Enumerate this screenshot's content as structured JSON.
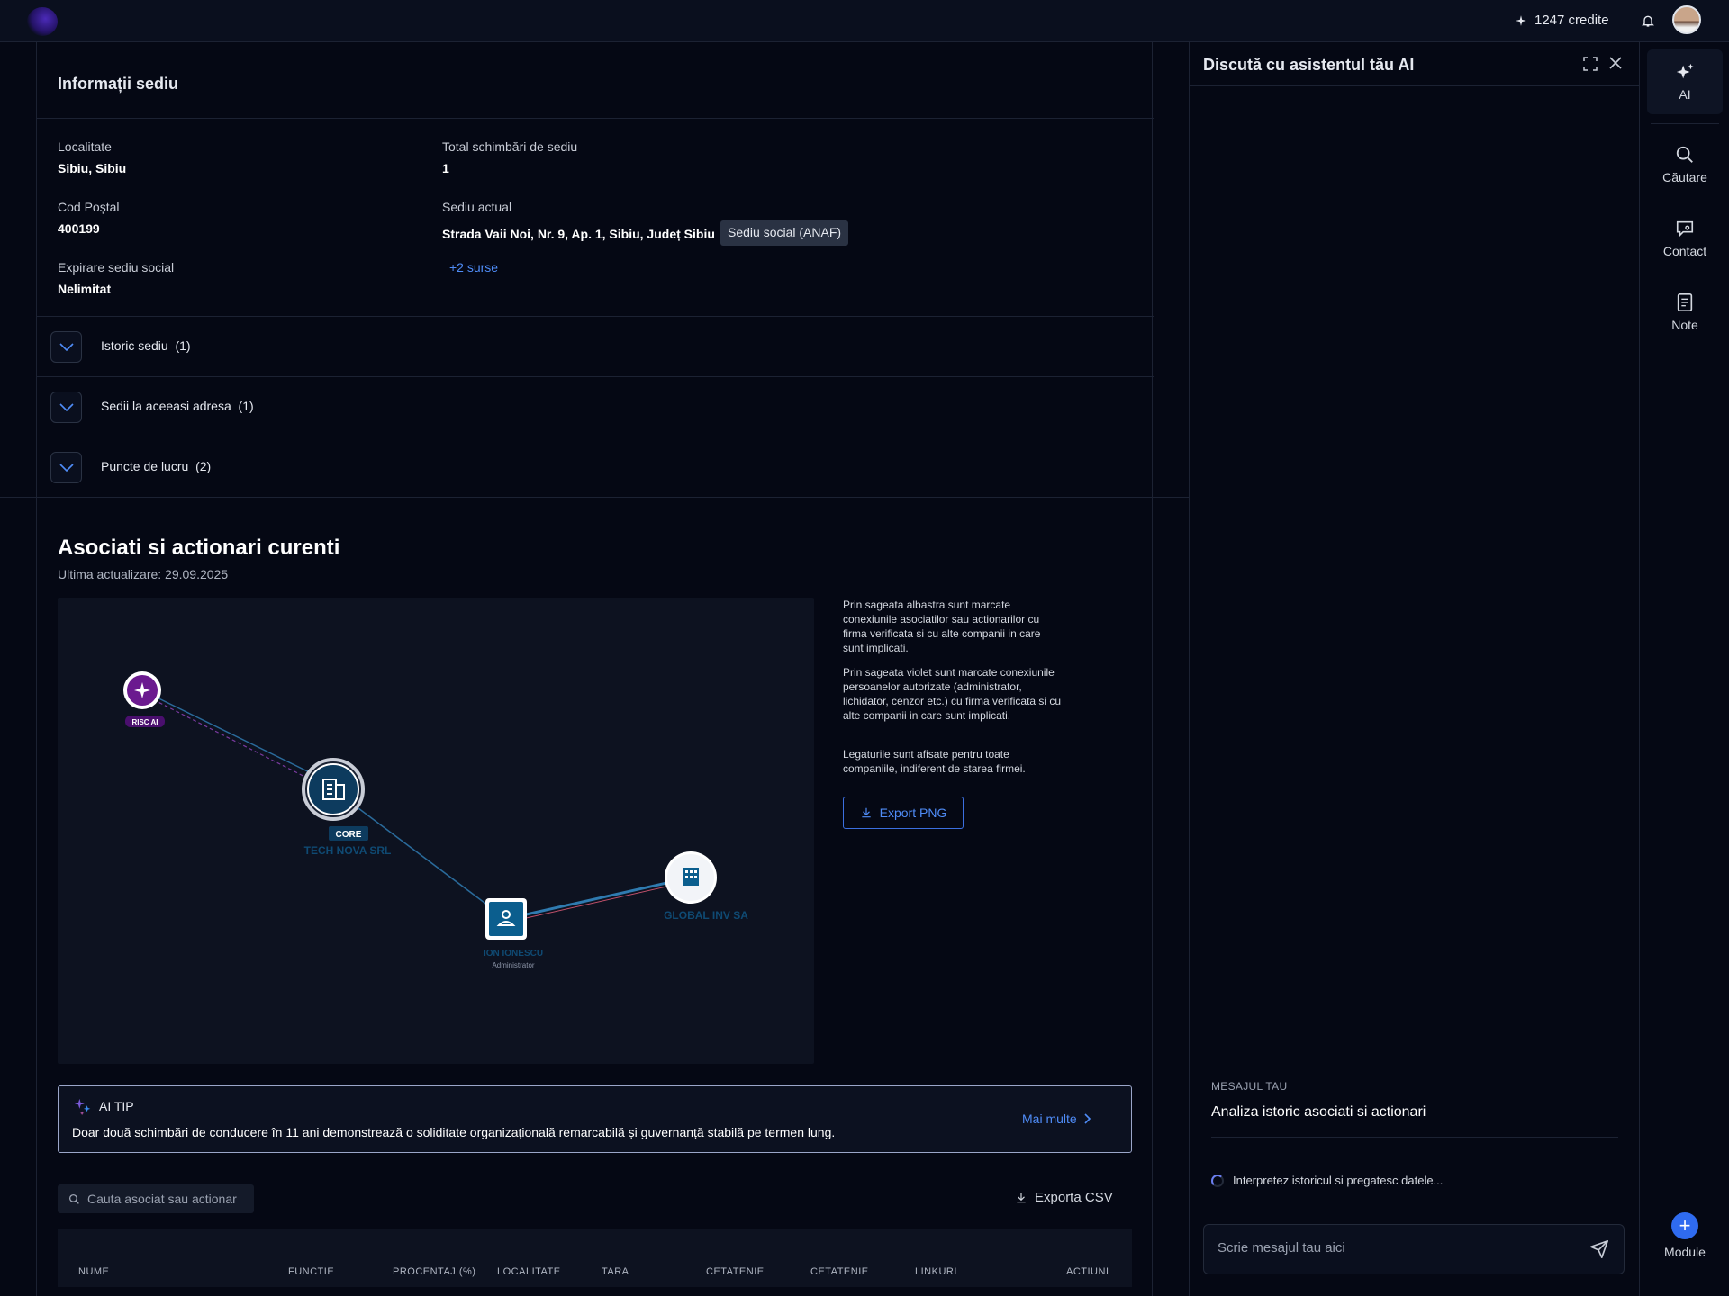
{
  "topbar": {
    "credits": "1247 credite"
  },
  "info": {
    "title": "Informații sediu",
    "localitate_label": "Localitate",
    "localitate_value": "Sibiu,  Sibiu",
    "cod_label": "Cod Poștal",
    "cod_value": "400199",
    "expirare_label": "Expirare sediu social",
    "expirare_value": "Nelimitat",
    "total_label": "Total schimbări de sediu",
    "total_value": "1",
    "sediu_label": "Sediu actual",
    "sediu_value": "Strada Vaii Noi, Nr. 9, Ap. 1, Sibiu, Județ Sibiu",
    "sediu_tag": "Sediu social (ANAF)",
    "sources_link": "+2 surse"
  },
  "accordion": [
    {
      "label": "Istoric sediu",
      "count": "(1)"
    },
    {
      "label": "Sedii la aceeasi adresa",
      "count": "(1)"
    },
    {
      "label": "Puncte de lucru",
      "count": "(2)"
    }
  ],
  "associates": {
    "title": "Asociati si actionari curenti",
    "updated": "Ultima actualizare: 29.09.2025",
    "graph": {
      "risk_badge": "RISC AI",
      "core_badge": "CORE",
      "core_name": "TECH NOVA SRL",
      "person_name": "ION IONESCU",
      "person_role": "Administrator",
      "company_name": "GLOBAL INV SA"
    },
    "legend_1": "Prin sageata albastra sunt marcate conexiunile asociatilor sau actionarilor cu firma verificata si cu alte companii in care sunt implicati.",
    "legend_2": "Prin sageata violet sunt marcate conexiunile persoanelor autorizate (administrator, lichidator, cenzor etc.) cu firma verificata si cu alte companii in care sunt implicati.",
    "legend_3": "Legaturile sunt afisate pentru toate companiile, indiferent de starea firmei.",
    "export_png": "Export PNG",
    "aitip_label": "AI TIP",
    "aitip_text": "Doar două schimbări de conducere în 11 ani demonstrează o soliditate organizațională remarcabilă și guvernanță stabilă pe termen lung.",
    "aitip_more": "Mai multe",
    "search_placeholder": "Cauta asociat sau actionar",
    "export_csv": "Exporta CSV",
    "columns": [
      "NUME",
      "FUNCTIE",
      "PROCENTAJ (%)",
      "LOCALITATE",
      "TARA",
      "CETATENIE",
      "CETATENIE",
      "LINKURI",
      "ACTIUNI"
    ]
  },
  "chat": {
    "title": "Discută cu asistentul tău AI",
    "msg_label": "MESAJUL TAU",
    "msg_text": "Analiza istoric asociati si actionari",
    "thinking": "Interpretez istoricul si pregatesc datele...",
    "input_placeholder": "Scrie mesajul tau aici"
  },
  "rail": {
    "ai": "AI",
    "search": "Căutare",
    "contact": "Contact",
    "note": "Note",
    "module": "Module"
  },
  "colors": {
    "accent": "#4f8cf7",
    "background": "#050814",
    "risk": "#6b1a8f",
    "node": "#0b5e8e"
  }
}
